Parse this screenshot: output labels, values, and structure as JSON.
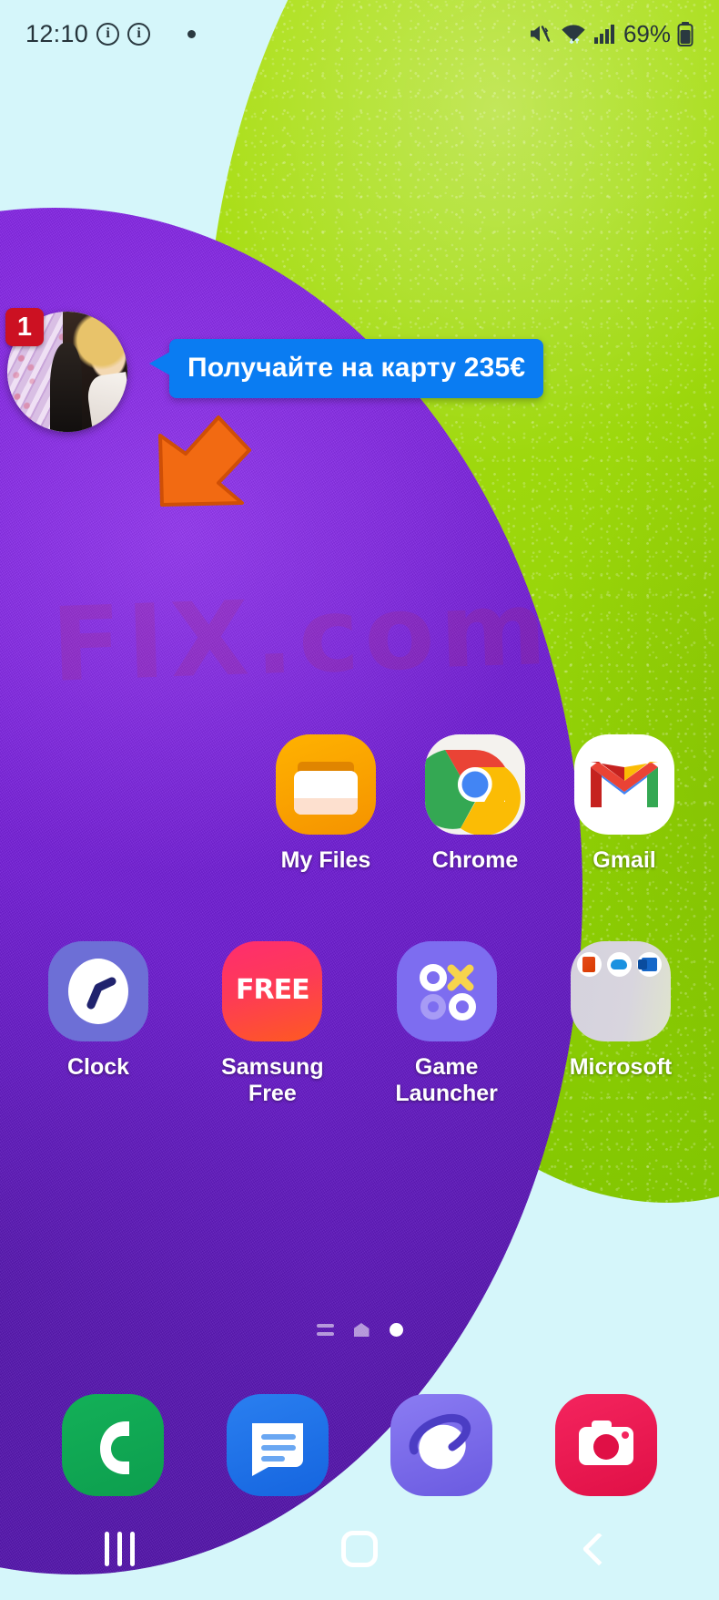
{
  "status_bar": {
    "time": "12:10",
    "icons_left": [
      "info-circle-icon",
      "info-circle-icon",
      "notification-dot"
    ],
    "info_glyph": "i",
    "icons_right": [
      "mute-vibrate-icon",
      "wifi-icon",
      "signal-bars-icon"
    ],
    "battery_percent": "69%",
    "battery_icon": "battery-icon"
  },
  "chat_head": {
    "badge_count": "1",
    "avatar_name": "contact-avatar",
    "bubble_text": "Получайте на карту 235€",
    "bubble_color": "#0a7cf2",
    "badge_color": "#cc1122",
    "pointer_icon": "orange-arrow-cursor"
  },
  "wallpaper": {
    "watermark": "FIX.com",
    "green_color": "#a7da1e",
    "purple_color": "#7a22dc",
    "sky_color": "#d5f6fa"
  },
  "home_screen": {
    "rows": [
      {
        "apps": [
          {
            "label": "My Files",
            "icon": "my-files-icon"
          },
          {
            "label": "Chrome",
            "icon": "chrome-icon"
          },
          {
            "label": "Gmail",
            "icon": "gmail-icon"
          }
        ]
      },
      {
        "apps": [
          {
            "label": "Clock",
            "icon": "clock-icon"
          },
          {
            "label": "Samsung Free",
            "icon": "samsung-free-icon"
          },
          {
            "label": "Game Launcher",
            "icon": "game-launcher-icon"
          },
          {
            "label": "Microsoft",
            "icon": "microsoft-folder-icon"
          }
        ]
      }
    ],
    "samsung_free_wordmark": "FREE",
    "page_indicator": {
      "items": [
        "lines-icon",
        "home-icon",
        "dot-icon"
      ],
      "active_index": 2
    }
  },
  "dock": {
    "apps": [
      {
        "label": "Phone",
        "icon": "phone-icon"
      },
      {
        "label": "Messages",
        "icon": "messages-icon"
      },
      {
        "label": "Samsung Internet",
        "icon": "internet-icon"
      },
      {
        "label": "Camera",
        "icon": "camera-icon"
      }
    ]
  },
  "nav_bar": {
    "buttons": [
      {
        "label": "Recents",
        "icon": "recents-icon"
      },
      {
        "label": "Home",
        "icon": "home-icon"
      },
      {
        "label": "Back",
        "icon": "back-icon"
      }
    ]
  }
}
